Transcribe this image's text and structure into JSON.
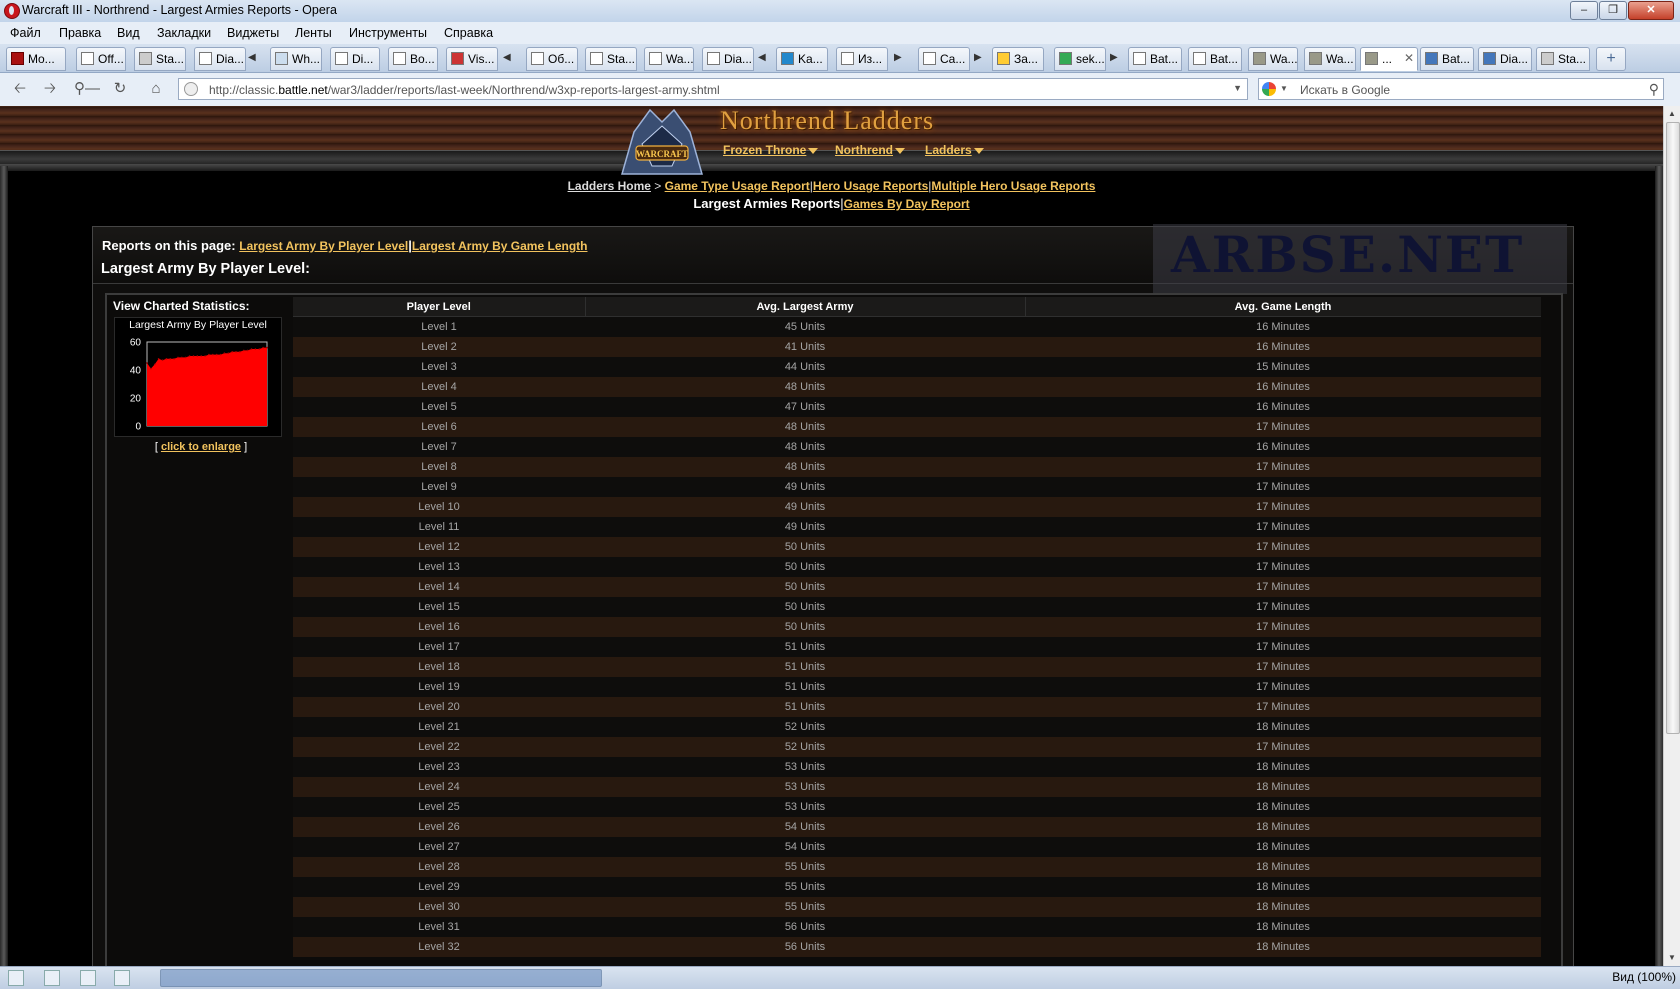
{
  "window": {
    "title": "Warcraft III - Northrend - Largest Armies Reports - Opera"
  },
  "menu": [
    "Файл",
    "Правка",
    "Вид",
    "Закладки",
    "Виджеты",
    "Ленты",
    "Инструменты",
    "Справка"
  ],
  "tabs": [
    "Mo...",
    "Off...",
    "Sta...",
    "Dia...",
    "Wh...",
    "Di...",
    "Bo...",
    "Vis...",
    "Об...",
    "Sta...",
    "Wa...",
    "Dia...",
    "Ka...",
    "Из...",
    "Ca...",
    "За...",
    "sek...",
    "Bat...",
    "Bat...",
    "Wa...",
    "Wa...",
    "...",
    "Bat...",
    "Dia...",
    "Sta..."
  ],
  "address": {
    "prefix": "http://classic.",
    "domain": "battle.net",
    "path": "/war3/ladder/reports/last-week/Northrend/w3xp-reports-largest-army.shtml",
    "search_placeholder": "Искать в Google"
  },
  "site": {
    "header_title": "Northrend Ladders",
    "nav": [
      "Frozen Throne",
      "Northrend",
      "Ladders"
    ],
    "crumbs": {
      "home": "Ladders Home",
      "sep": ">",
      "links": [
        "Game Type Usage Report",
        "Hero Usage Reports",
        "Multiple Hero Usage Reports"
      ]
    },
    "subtitle": {
      "current": "Largest Armies Reports",
      "link": "Games By Day Report"
    },
    "reports_label": "Reports on this page:",
    "report_links": [
      "Largest Army By Player Level",
      "Largest Army By Game Length"
    ],
    "section_title": "Largest Army By Player Level:",
    "watermark": "ARBSE.NET",
    "chart_side": {
      "heading": "View Charted Statistics:",
      "enlarge_link": "click to enlarge"
    }
  },
  "table": {
    "headers": [
      "Player Level",
      "Avg. Largest Army",
      "Avg. Game Length"
    ],
    "rows": [
      [
        "Level 1",
        "45 Units",
        "16 Minutes"
      ],
      [
        "Level 2",
        "41 Units",
        "16 Minutes"
      ],
      [
        "Level 3",
        "44 Units",
        "15 Minutes"
      ],
      [
        "Level 4",
        "48 Units",
        "16 Minutes"
      ],
      [
        "Level 5",
        "47 Units",
        "16 Minutes"
      ],
      [
        "Level 6",
        "48 Units",
        "17 Minutes"
      ],
      [
        "Level 7",
        "48 Units",
        "16 Minutes"
      ],
      [
        "Level 8",
        "48 Units",
        "17 Minutes"
      ],
      [
        "Level 9",
        "49 Units",
        "17 Minutes"
      ],
      [
        "Level 10",
        "49 Units",
        "17 Minutes"
      ],
      [
        "Level 11",
        "49 Units",
        "17 Minutes"
      ],
      [
        "Level 12",
        "50 Units",
        "17 Minutes"
      ],
      [
        "Level 13",
        "50 Units",
        "17 Minutes"
      ],
      [
        "Level 14",
        "50 Units",
        "17 Minutes"
      ],
      [
        "Level 15",
        "50 Units",
        "17 Minutes"
      ],
      [
        "Level 16",
        "50 Units",
        "17 Minutes"
      ],
      [
        "Level 17",
        "51 Units",
        "17 Minutes"
      ],
      [
        "Level 18",
        "51 Units",
        "17 Minutes"
      ],
      [
        "Level 19",
        "51 Units",
        "17 Minutes"
      ],
      [
        "Level 20",
        "51 Units",
        "17 Minutes"
      ],
      [
        "Level 21",
        "52 Units",
        "18 Minutes"
      ],
      [
        "Level 22",
        "52 Units",
        "17 Minutes"
      ],
      [
        "Level 23",
        "53 Units",
        "18 Minutes"
      ],
      [
        "Level 24",
        "53 Units",
        "18 Minutes"
      ],
      [
        "Level 25",
        "53 Units",
        "18 Minutes"
      ],
      [
        "Level 26",
        "54 Units",
        "18 Minutes"
      ],
      [
        "Level 27",
        "54 Units",
        "18 Minutes"
      ],
      [
        "Level 28",
        "55 Units",
        "18 Minutes"
      ],
      [
        "Level 29",
        "55 Units",
        "18 Minutes"
      ],
      [
        "Level 30",
        "55 Units",
        "18 Minutes"
      ],
      [
        "Level 31",
        "56 Units",
        "18 Minutes"
      ],
      [
        "Level 32",
        "56 Units",
        "18 Minutes"
      ]
    ]
  },
  "chart_data": {
    "type": "area",
    "title": "Largest Army By Player Level",
    "x": [
      1,
      2,
      3,
      4,
      5,
      6,
      7,
      8,
      9,
      10,
      11,
      12,
      13,
      14,
      15,
      16,
      17,
      18,
      19,
      20,
      21,
      22,
      23,
      24,
      25,
      26,
      27,
      28,
      29,
      30,
      31,
      32
    ],
    "values": [
      45,
      41,
      44,
      48,
      47,
      48,
      48,
      48,
      49,
      49,
      49,
      50,
      50,
      50,
      50,
      50,
      51,
      51,
      51,
      51,
      52,
      52,
      53,
      53,
      53,
      54,
      54,
      55,
      55,
      55,
      56,
      56
    ],
    "ylim": [
      0,
      60
    ],
    "yticks": [
      "60",
      "40",
      "20",
      "0"
    ],
    "color": "#ff0000"
  },
  "statusbar": {
    "zoom": "Вид (100%)"
  },
  "colors": {
    "link": "#f2c35e",
    "row_alt": "#28190f",
    "area": "#ff0000"
  }
}
